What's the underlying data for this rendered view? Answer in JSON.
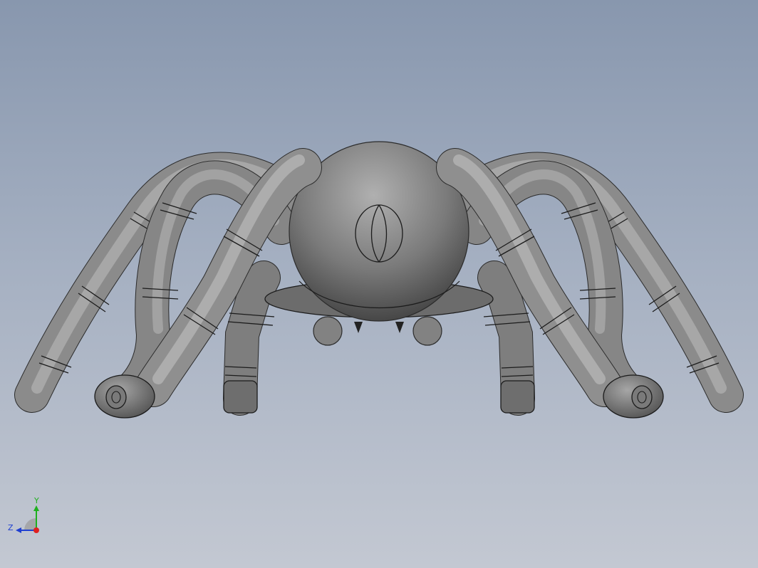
{
  "viewport": {
    "background_top": "#8897ae",
    "background_bottom": "#c3c8d2",
    "model_name": "spider"
  },
  "triad": {
    "y_label": "Y",
    "z_label": "Z",
    "colors": {
      "x": "#e02020",
      "y": "#1fb01f",
      "z": "#1f3fd0"
    }
  }
}
